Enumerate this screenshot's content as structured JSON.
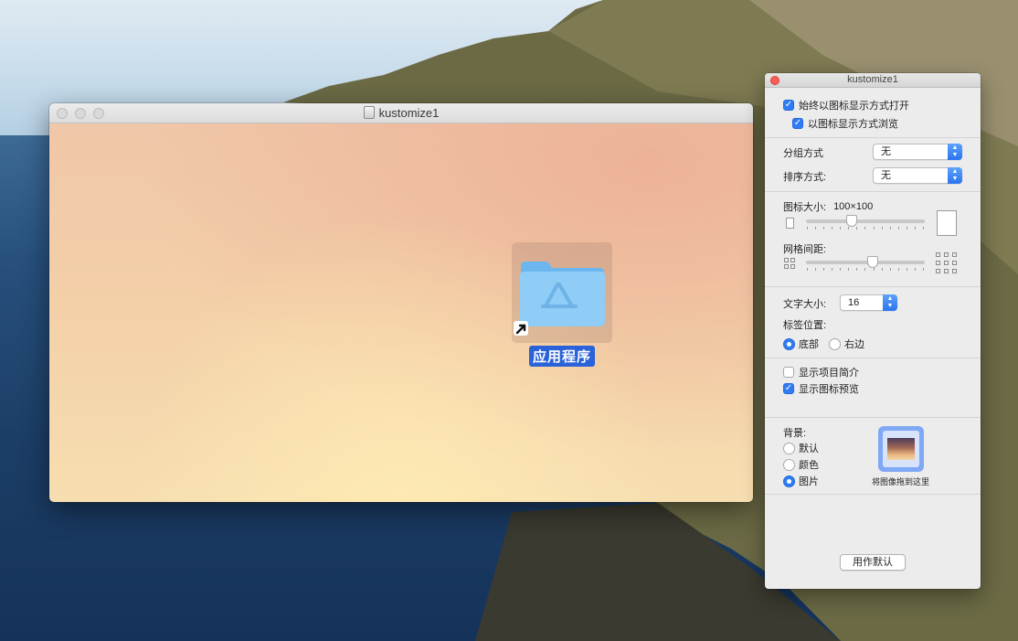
{
  "finder": {
    "title": "kustomize1",
    "item_label": "应用程序",
    "icon": "applications-folder-alias-icon"
  },
  "panel": {
    "title": "kustomize1",
    "always_open_icon_view": {
      "label": "始终以图标显示方式打开",
      "checked": true
    },
    "browse_icon_view": {
      "label": "以图标显示方式浏览",
      "checked": true
    },
    "group_by": {
      "label": "分组方式",
      "value": "无"
    },
    "sort_by": {
      "label": "排序方式:",
      "value": "无"
    },
    "icon_size": {
      "label": "图标大小:",
      "value": "100×100"
    },
    "grid_spacing": {
      "label": "网格间距:"
    },
    "text_size": {
      "label": "文字大小:",
      "value": "16"
    },
    "label_position": {
      "label": "标签位置:",
      "options": [
        {
          "label": "底部",
          "selected": true
        },
        {
          "label": "右边",
          "selected": false
        }
      ]
    },
    "show_item_info": {
      "label": "显示项目简介",
      "checked": false
    },
    "show_icon_preview": {
      "label": "显示图标预览",
      "checked": true
    },
    "background": {
      "label": "背景:",
      "options": [
        {
          "label": "默认",
          "selected": false
        },
        {
          "label": "颜色",
          "selected": false
        },
        {
          "label": "图片",
          "selected": true
        }
      ],
      "drop_hint": "将图像拖到这里"
    },
    "use_as_defaults": "用作默认"
  },
  "colors": {
    "accent": "#2f7cf6",
    "selection": "#2a62d9",
    "close": "#fd5c55"
  }
}
